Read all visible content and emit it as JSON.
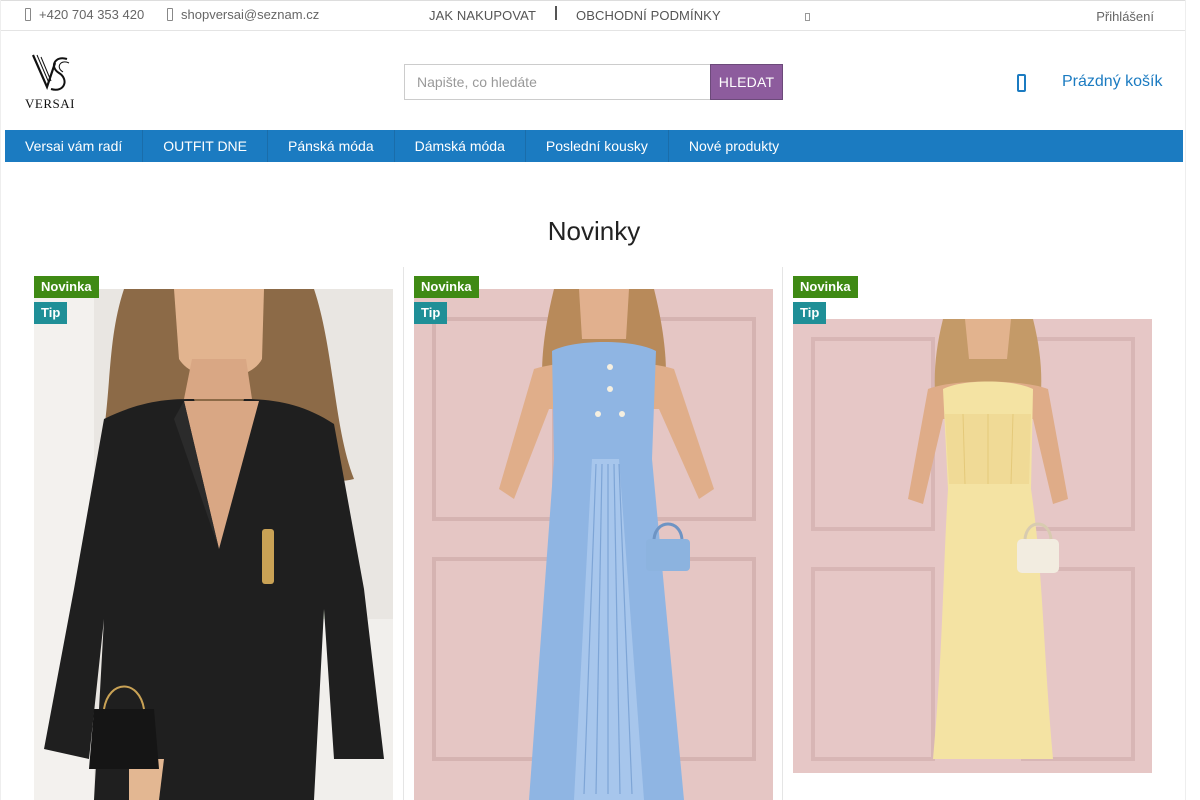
{
  "topbar": {
    "phone": "+420 704 353 420",
    "email": "shopversai@seznam.cz",
    "links": [
      "JAK NAKUPOVAT",
      "OBCHODNÍ PODMÍNKY"
    ],
    "login": "Přihlášení"
  },
  "header": {
    "logo_text": "VERSAI",
    "search_placeholder": "Napište, co hledáte",
    "search_button": "HLEDAT",
    "cart_label": "Prázdný košík"
  },
  "nav": {
    "items": [
      "Versai vám radí",
      "OUTFIT DNE",
      "Pánská móda",
      "Dámská móda",
      "Poslední kousky",
      "Nové produkty"
    ]
  },
  "section": {
    "title": "Novinky"
  },
  "products": [
    {
      "flag_new": "Novinka",
      "flag_tip": "Tip",
      "image": "black wrap blazer dress"
    },
    {
      "flag_new": "Novinka",
      "flag_tip": "Tip",
      "image": "light blue pleated strapless dress"
    },
    {
      "flag_new": "Novinka",
      "flag_tip": "Tip",
      "image": "yellow corset maxi dress"
    }
  ],
  "colors": {
    "nav_bg": "#1b7bc1",
    "search_button_bg": "#8d5c9d",
    "flag_new_bg": "#3f8a14",
    "flag_tip_bg": "#1f8f97",
    "cart_link": "#1b7bc1"
  }
}
